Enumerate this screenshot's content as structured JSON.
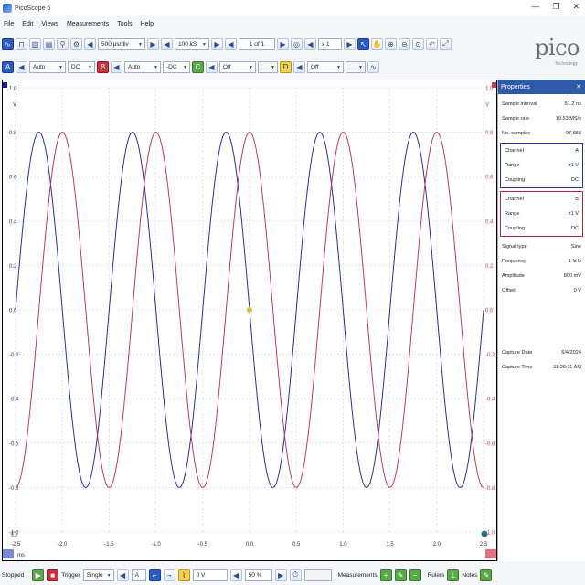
{
  "window": {
    "title": "PicoScope 6",
    "controls": [
      "—",
      "❐",
      "✕"
    ]
  },
  "menu": [
    "File",
    "Edit",
    "Views",
    "Measurements",
    "Tools",
    "Help"
  ],
  "toolbar1": {
    "timebase": "500 µs/div",
    "samples": "100 kS",
    "buffer": "1 of 1",
    "zoom": "x 1"
  },
  "toolbar2": {
    "channel_a": {
      "label": "A",
      "range": "Auto",
      "coupling": "DC"
    },
    "channel_b": {
      "label": "B",
      "range": "Auto",
      "coupling": "-DC"
    },
    "channel_c": {
      "label": "C",
      "range": "Off"
    },
    "channel_d": {
      "label": "D",
      "range": "Off"
    }
  },
  "logo": {
    "word": "pico",
    "sub": "Technology"
  },
  "chart_data": {
    "type": "line",
    "x_ticks": [
      "-2.5",
      "-2.0",
      "-1.5",
      "-1.0",
      "-0.5",
      "0.0",
      "0.5",
      "1.0",
      "1.5",
      "2.0",
      "2.5"
    ],
    "y_ticks_left": [
      "1.0",
      "0.8",
      "0.6",
      "0.4",
      "0.2",
      "0.0",
      "-0.2",
      "-0.4",
      "-0.6",
      "-0.8",
      "-1.0"
    ],
    "y_ticks_right": [
      "1.0",
      "0.8",
      "0.6",
      "0.4",
      "0.2",
      "0.0",
      "-0.2",
      "-0.4",
      "-0.6",
      "-0.8",
      "-1.0"
    ],
    "x_unit": "ms",
    "y_unit_left": "V",
    "y_unit_right": "V",
    "xlim": [
      -2.5,
      2.5
    ],
    "ylim": [
      -1.0,
      1.0
    ],
    "grid": true,
    "series": [
      {
        "name": "A",
        "color": "#2a2f9e",
        "frequency_khz": 1,
        "amplitude": 0.8,
        "phase_deg": 180
      },
      {
        "name": "B",
        "color": "#c23a55",
        "frequency_khz": 1,
        "amplitude": 0.8,
        "phase_deg": 90
      }
    ],
    "trigger_marker_color": "#e8c820"
  },
  "properties": {
    "header": "Properties",
    "general": [
      {
        "k": "Sample interval",
        "v": "51.2 ns"
      },
      {
        "k": "Sample rate",
        "v": "19.53 MS/s"
      },
      {
        "k": "No. samples",
        "v": "97,656"
      }
    ],
    "channel_a": [
      {
        "k": "Channel",
        "v": "A"
      },
      {
        "k": "Range",
        "v": "±1 V"
      },
      {
        "k": "Coupling",
        "v": "DC"
      }
    ],
    "channel_b": [
      {
        "k": "Channel",
        "v": "B"
      },
      {
        "k": "Range",
        "v": "±1 V"
      },
      {
        "k": "Coupling",
        "v": "DC"
      }
    ],
    "signal": [
      {
        "k": "Signal type",
        "v": "Sine"
      },
      {
        "k": "Frequency",
        "v": "1 kHz"
      },
      {
        "k": "Amplitude",
        "v": "800 mV"
      },
      {
        "k": "Offset",
        "v": "0 V"
      }
    ],
    "capture": [
      {
        "k": "Capture Date",
        "v": "6/4/2024"
      },
      {
        "k": "Capture Time",
        "v": "11:26:11 AM"
      }
    ]
  },
  "statusbar": {
    "state": "Stopped",
    "trigger_label": "Trigger",
    "trigger_mode": "Single",
    "trigger_source": "A",
    "threshold": "0 V",
    "pre_trigger": "50 %",
    "measurements": "Measurements",
    "rulers": "Rulers",
    "notes": "Notes"
  }
}
